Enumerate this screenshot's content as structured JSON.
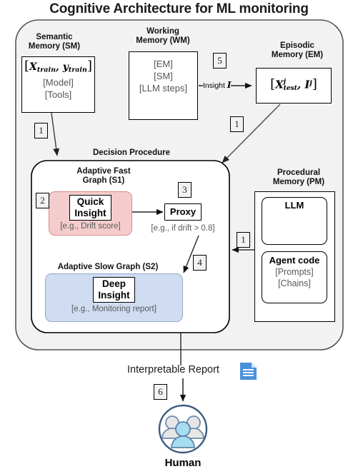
{
  "title": "Cognitive Architecture for ML monitoring",
  "semantic_memory": {
    "caption_line1": "Semantic",
    "caption_line2": "Memory (SM)",
    "items": [
      "[Model]",
      "[Tools]"
    ],
    "math_open": "[",
    "math_x": "X",
    "math_x_sub": "train",
    "math_comma": ", ",
    "math_y": "y",
    "math_y_sub": "train",
    "math_close": "]"
  },
  "working_memory": {
    "caption_line1": "Working",
    "caption_line2": "Memory (WM)",
    "items": [
      "[EM]",
      "[SM]",
      "[LLM steps]"
    ]
  },
  "episodic_memory": {
    "caption_line1": "Episodic",
    "caption_line2": "Memory (EM)",
    "math_open": "[",
    "math_x": "X",
    "math_x_sub": "test",
    "math_x_sup": "j",
    "math_comma": ", ",
    "math_i": "I",
    "math_i_sup": "j",
    "math_close": "]"
  },
  "procedural_memory": {
    "caption_line1": "Procedural",
    "caption_line2": "Memory (PM)",
    "llm_label": "LLM",
    "agent_code_label": "Agent code",
    "agent_code_items": [
      "[Prompts]",
      "[Chains]"
    ]
  },
  "decision_procedure": {
    "caption": "Decision Procedure",
    "fast_graph": {
      "caption_line1": "Adaptive Fast",
      "caption_line2": "Graph (S1)",
      "insight_line1": "Quick",
      "insight_line2": "Insight",
      "example": "[e.g., Drift score]"
    },
    "slow_graph": {
      "caption": "Adaptive Slow Graph (S2)",
      "insight_line1": "Deep",
      "insight_line2": "Insight",
      "example": "[e.g., Monitoring report]"
    },
    "proxy": {
      "label": "Proxy",
      "example": "[e.g., if drift > 0.8]"
    }
  },
  "links": {
    "insight_label_text": "Insight ",
    "insight_label_symbol": "I"
  },
  "steps": {
    "sm_to_dp": "1",
    "fast_graph": "2",
    "proxy": "3",
    "to_slow_graph": "4",
    "wm_to_em": "5",
    "pm_to_dp": "1",
    "em_to_dp": "1",
    "report_to_human": "6"
  },
  "output": {
    "report_label": "Interpretable Report",
    "report_icon": "document-icon",
    "human_label": "Human",
    "human_icon": "people-icon"
  },
  "colors": {
    "outer_container_fill": "#f2f2f2",
    "outer_container_stroke": "#555555",
    "decision_fill": "#ffffff",
    "decision_stroke": "#000000",
    "quick_insight_fill": "#f4cccc",
    "quick_insight_stroke": "#d98a8a",
    "deep_insight_fill": "#cfdcf2",
    "deep_insight_stroke": "#93a9c9",
    "report_icon_color": "#4a90d9",
    "human_ring_color": "#3d5a80",
    "human_center_color": "#a8dcf0",
    "human_side_color": "#e6e6e6"
  }
}
